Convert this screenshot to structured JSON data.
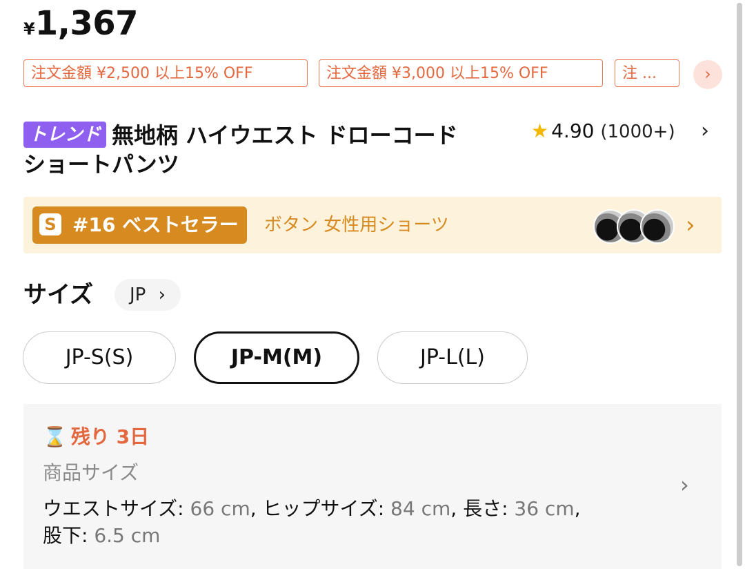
{
  "price": {
    "currency": "¥",
    "amount": "1,367"
  },
  "coupons": [
    "注文金額 ¥2,500 以上15% OFF",
    "注文金額 ¥3,000 以上15% OFF",
    "注 ..."
  ],
  "coupon_more": "›",
  "product": {
    "badge": "トレンド",
    "title_line1": "無地柄 ハイウエスト ドローコード",
    "title_line2": "ショートパンツ",
    "rating_value": "4.90",
    "rating_count": "(1000+)"
  },
  "bestseller": {
    "icon_letter": "S",
    "rank": "#16 ベストセラー",
    "category": "ボタン 女性用ショーツ",
    "chevron": "›"
  },
  "size": {
    "label": "サイズ",
    "region": "JP",
    "options": [
      "JP-S(S)",
      "JP-M(M)",
      "JP-L(L)"
    ],
    "selected": "JP-M(M)"
  },
  "size_info": {
    "remaining": "残り 3日",
    "section_label": "商品サイズ",
    "waist_label": "ウエストサイズ:",
    "waist_value": "66 cm",
    "hip_label": "ヒップサイズ:",
    "hip_value": "84 cm",
    "length_label": "長さ:",
    "length_value": "36 cm",
    "inseam_label": "股下:",
    "inseam_value": "6.5 cm"
  },
  "colors": {
    "accent_orange": "#e3683f",
    "trend_purple": "#8f5ff0",
    "bestseller_gold": "#d68a1f",
    "star_yellow": "#f5b700"
  }
}
